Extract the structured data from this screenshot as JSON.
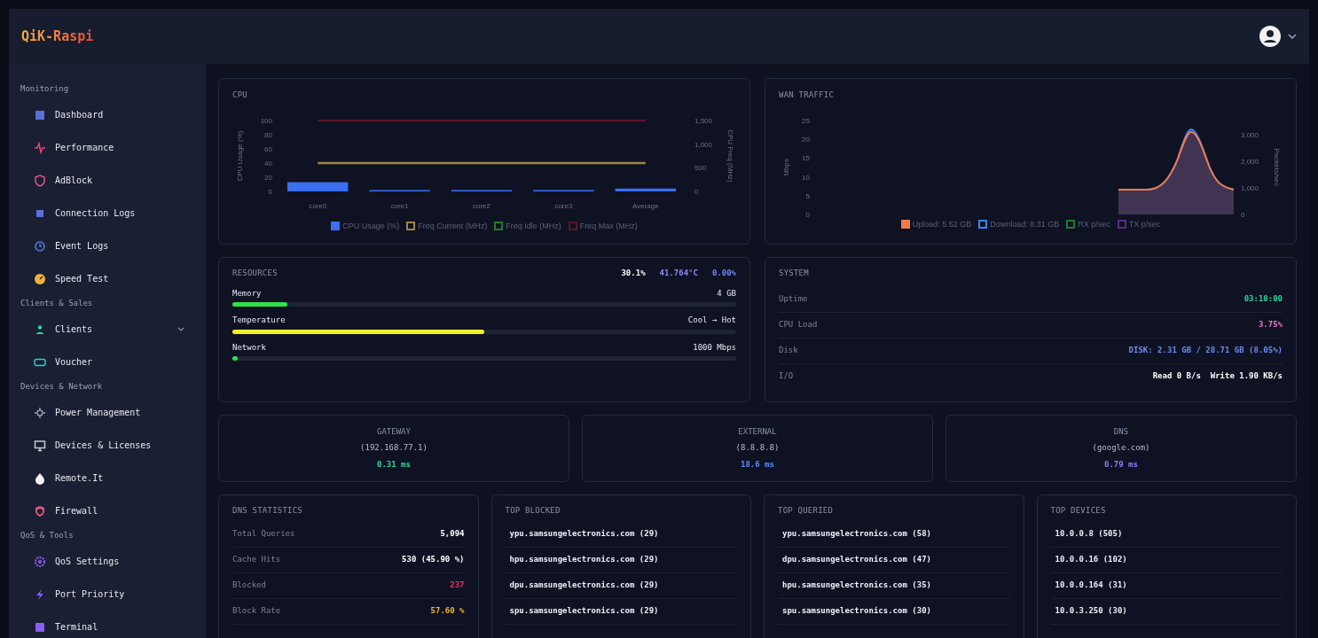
{
  "header": {
    "logo": "QiK-Raspi"
  },
  "sidebar": {
    "sections": [
      {
        "title": "Monitoring",
        "items": [
          {
            "label": "Dashboard",
            "selected": false
          },
          {
            "label": "Performance",
            "selected": false
          },
          {
            "label": "AdBlock",
            "selected": false
          },
          {
            "label": "Connection Logs",
            "selected": false
          },
          {
            "label": "Event Logs",
            "selected": false
          },
          {
            "label": "Speed Test",
            "selected": false
          }
        ]
      },
      {
        "title": "Clients & Sales",
        "items": [
          {
            "label": "Clients",
            "selected": false,
            "expandable": true
          },
          {
            "label": "Voucher",
            "selected": false
          }
        ]
      },
      {
        "title": "Devices & Network",
        "items": [
          {
            "label": "Power Management",
            "selected": false
          },
          {
            "label": "Devices & Licenses",
            "selected": false
          },
          {
            "label": "Remote.It",
            "selected": false
          },
          {
            "label": "Firewall",
            "selected": false
          }
        ]
      },
      {
        "title": "QoS & Tools",
        "items": [
          {
            "label": "QoS Settings",
            "selected": false
          },
          {
            "label": "Port Priority",
            "selected": false
          },
          {
            "label": "Terminal",
            "selected": false
          }
        ]
      }
    ]
  },
  "cpu": {
    "title": "CPU",
    "chart_data": {
      "type": "bar",
      "ylabel": "CPU Usage (%)",
      "y2label": "CPU Freq (MHz)",
      "categories": [
        "core0",
        "core1",
        "core2",
        "core3",
        "Average"
      ],
      "legend": true,
      "ylim": [
        0,
        100
      ],
      "y2lim": [
        0,
        1500
      ],
      "yticks": [
        0,
        20,
        40,
        60,
        80,
        100
      ],
      "y2ticks": [
        0,
        500,
        {
          "value": 1000,
          "label": "1,000"
        },
        {
          "value": 1500,
          "label": "1,500"
        }
      ],
      "series": [
        {
          "name": "CPU Usage (%)",
          "color": "#3b6ff0",
          "type": "bar",
          "axis": "y",
          "values": [
            13,
            0,
            1,
            1,
            4
          ]
        },
        {
          "name": "Freq Current (MHz)",
          "color": "#a08448",
          "type": "line",
          "axis": "y2",
          "values": [
            600,
            600,
            600,
            600,
            600
          ]
        },
        {
          "name": "Freq Idle (MHz)",
          "color": "#1f7a2e",
          "type": "line",
          "axis": "y2",
          "values": [
            null,
            null,
            null,
            null,
            null
          ]
        },
        {
          "name": "Freq Max (MHz)",
          "color": "#5a1626",
          "type": "line",
          "axis": "y2",
          "values": [
            1500,
            1500,
            1500,
            1500,
            1500
          ]
        }
      ]
    }
  },
  "wan": {
    "title": "WAN TRAFFIC",
    "ylabel": "Mbps",
    "y2label": "Packets/sec",
    "y_tick_labels": [
      "25",
      "20",
      "15",
      "10",
      "5",
      "0"
    ],
    "y2_tick_labels": [
      "3,000",
      "2,000",
      "1,000",
      "0"
    ],
    "legend": [
      {
        "name": "Upload: 5.52 GB",
        "color": "#f07a4a"
      },
      {
        "name": "Download: 8.31 GB",
        "color": "#3b82f6"
      },
      {
        "name": "RX p/sec",
        "color": "#1f7a2e"
      },
      {
        "name": "TX p/sec",
        "color": "#5b2a8a"
      }
    ]
  },
  "resources": {
    "title": "RESOURCES",
    "summary": [
      {
        "text": "30.1%",
        "color": "#ffffff"
      },
      {
        "text": "41.764°C",
        "color": "#8b8cf8"
      },
      {
        "text": "0.00%",
        "color": "#6b8cf8"
      }
    ],
    "meters": [
      {
        "label": "Memory",
        "reading": "4 GB",
        "level": 0.11,
        "color": "#32e04a"
      },
      {
        "label": "Temperature",
        "reading": "Cool → Hot",
        "level": 0.5,
        "color": "#f2f02a"
      },
      {
        "label": "Network",
        "reading": "1000 Mbps",
        "level": 0.01,
        "color": "#32e04a"
      }
    ]
  },
  "system": {
    "title": "SYSTEM",
    "rows": [
      {
        "label": "Uptime",
        "value": "03:10:00",
        "color": "#34d399"
      },
      {
        "label": "CPU Load",
        "value": "3.75%",
        "color": "#e879c9"
      },
      {
        "label": "Disk",
        "value": "DISK: 2.31 GB / 28.71 GB (8.05%)",
        "color": "#6b8cf8"
      },
      {
        "label": "I/O",
        "value": "Read 0 B/s  Write 1.90 KB/s",
        "color": "#ffffff"
      }
    ]
  },
  "pings": [
    {
      "title": "GATEWAY",
      "target": "(192.168.77.1)",
      "value": "0.31 ms",
      "color": "#34d399"
    },
    {
      "title": "EXTERNAL",
      "target": "(8.8.8.8)",
      "value": "18.6 ms",
      "color": "#5b8cf8"
    },
    {
      "title": "DNS",
      "target": "(google.com)",
      "value": "0.79 ms",
      "color": "#8b7cf8"
    }
  ],
  "dns_statistics": {
    "title": "DNS STATISTICS",
    "rows": [
      {
        "label": "Total Queries",
        "value": "5,094",
        "color": "#ffffff"
      },
      {
        "label": "Cache Hits",
        "value": "530 (45.90 %)",
        "color": "#ffffff"
      },
      {
        "label": "Blocked",
        "value": "237",
        "color": "#e5365f"
      },
      {
        "label": "Block Rate",
        "value": "57.60 %",
        "color": "#f0b23a"
      }
    ]
  },
  "top_blocked": {
    "title": "TOP BLOCKED",
    "items": [
      "ypu.samsungelectronics.com (29)",
      "hpu.samsungelectronics.com (29)",
      "dpu.samsungelectronics.com (29)",
      "spu.samsungelectronics.com (29)"
    ]
  },
  "top_queried": {
    "title": "TOP QUERIED",
    "items": [
      "ypu.samsungelectronics.com (58)",
      "dpu.samsungelectronics.com (47)",
      "hpu.samsungelectronics.com (35)",
      "spu.samsungelectronics.com (30)"
    ]
  },
  "top_devices": {
    "title": "TOP DEVICES",
    "items": [
      "10.0.0.8 (505)",
      "10.0.0.16 (102)",
      "10.0.0.164 (31)",
      "10.0.3.250 (30)"
    ]
  }
}
